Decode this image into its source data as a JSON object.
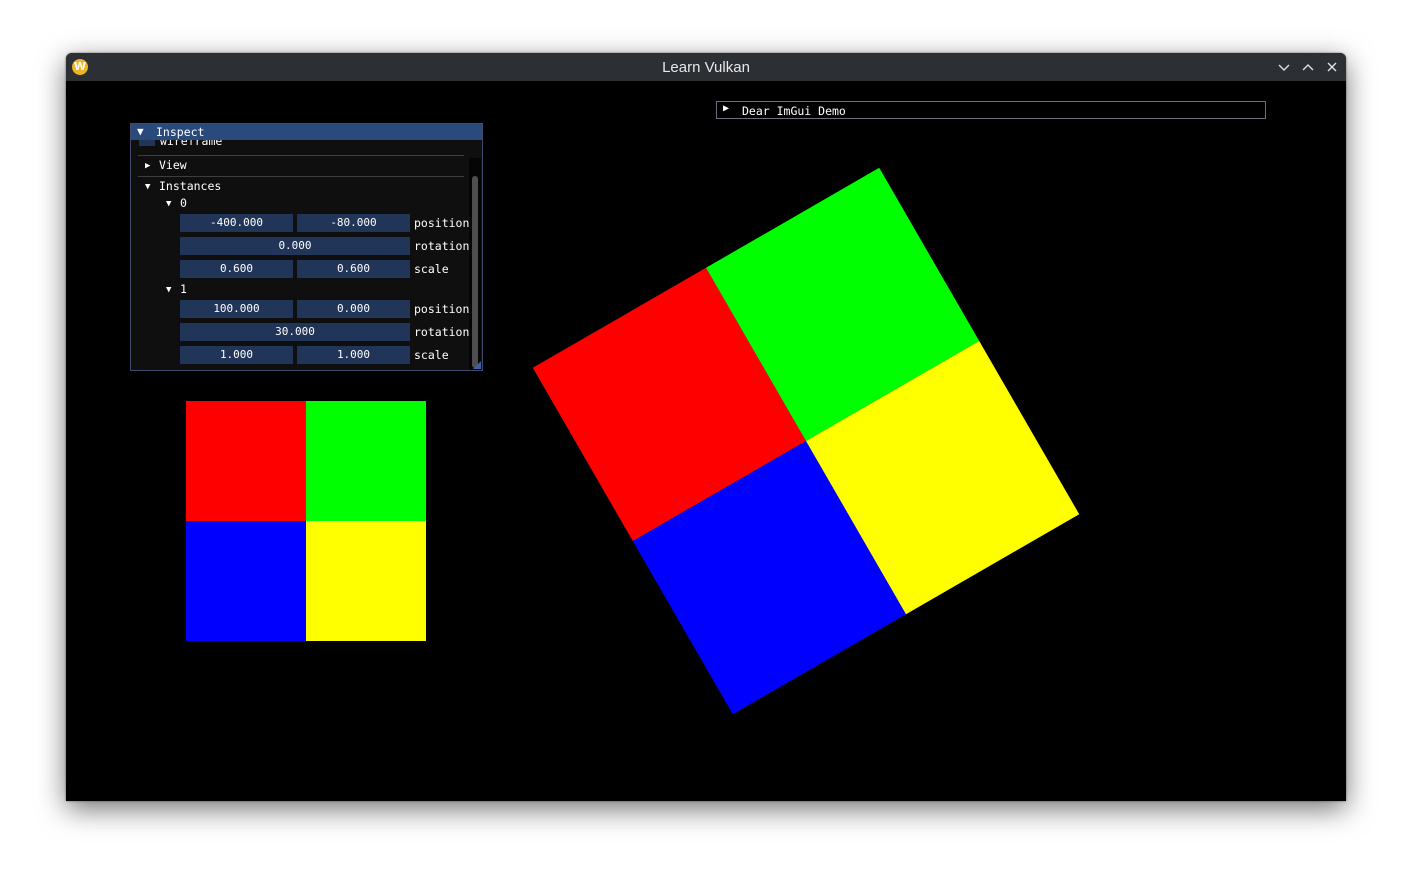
{
  "window": {
    "title": "Learn Vulkan",
    "app_icon": "W"
  },
  "inspect": {
    "title": "Inspect",
    "wireframe_label": "wireframe",
    "view_label": "View",
    "instances_label": "Instances",
    "instances": [
      {
        "index": "0",
        "position": [
          "-400.000",
          "-80.000"
        ],
        "rotation": "0.000",
        "scale": [
          "0.600",
          "0.600"
        ]
      },
      {
        "index": "1",
        "position": [
          "100.000",
          "0.000"
        ],
        "rotation": "30.000",
        "scale": [
          "1.000",
          "1.000"
        ]
      }
    ],
    "labels": {
      "position": "position",
      "rotation": "rotation",
      "scale": "scale"
    }
  },
  "demo_window": {
    "title": "Dear ImGui Demo"
  },
  "quad_colors": {
    "top_left": "#ff0000",
    "top_right": "#00ff00",
    "bottom_left": "#0000ff",
    "bottom_right": "#ffff00"
  }
}
